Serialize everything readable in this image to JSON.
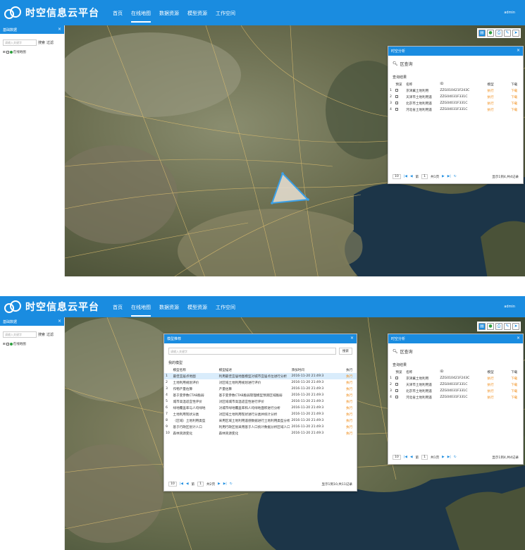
{
  "app": {
    "logo_text": "时空信息云平台",
    "nav": [
      "首页",
      "在线地图",
      "数据资源",
      "模型资源",
      "工作空间"
    ],
    "active_nav": "在线地图",
    "user": "admin"
  },
  "sidebar": {
    "title": "基础数据",
    "search_placeholder": "请输入关键字",
    "search_button": "搜索",
    "filter_button": "过滤",
    "tree_item": "在线地图"
  },
  "toolbar_icons": [
    "layers-icon",
    "globe-icon",
    "print-icon",
    "draw-icon",
    "pointer-icon"
  ],
  "query_panel": {
    "title": "时空分析",
    "query_label": "区查询",
    "result_title": "查询结果",
    "columns": [
      "预览",
      "名称",
      "ID",
      "模型",
      "下载"
    ],
    "rows": [
      {
        "n": "1",
        "name": "京津冀土地利用",
        "id": "ZZG010421F243C",
        "model": "执行",
        "dl": "下载"
      },
      {
        "n": "2",
        "name": "天津市土地利用遥",
        "id": "ZZG04031F331C",
        "model": "执行",
        "dl": "下载"
      },
      {
        "n": "3",
        "name": "北京市土地利用遥",
        "id": "ZZG04031F331C",
        "model": "执行",
        "dl": "下载"
      },
      {
        "n": "4",
        "name": "河北省土地利用遥",
        "id": "ZZG04031F331C",
        "model": "执行",
        "dl": "下载"
      }
    ],
    "pager": {
      "size": "10",
      "page_label": "第",
      "page": "1",
      "total": "共1页",
      "info": "显示1到4,共4记录"
    }
  },
  "model_panel": {
    "title": "模型推荐",
    "search_placeholder": "请输入关键字",
    "search_button": "搜索",
    "section": "我的模型",
    "columns": [
      "模型名称",
      "模型描述",
      "添加时间",
      "执行"
    ],
    "rows": [
      {
        "n": "1",
        "name": "最佳宜居点地图",
        "desc": "利用最佳宜居地图模型对城市宜居点位进行分析",
        "time": "2016-11-20 21:49:3",
        "exec": "执行"
      },
      {
        "n": "2",
        "name": "土地利用规划评价",
        "desc": "对区域土地利用规划进行评价",
        "time": "2016-11-20 21:49:3",
        "exec": "执行"
      },
      {
        "n": "3",
        "name": "作物产量估算",
        "desc": "产量估算",
        "time": "2016-11-20 21:49:3",
        "exec": "执行"
      },
      {
        "n": "4",
        "name": "基于变参数CTAB脆弱",
        "desc": "基于变参数CTAB脆弱管理模型预测区域脆弱",
        "time": "2016-11-20 21:49:3",
        "exec": "执行"
      },
      {
        "n": "5",
        "name": "城市高温适宜性评价",
        "desc": "对区域城市高温适宜性进行评价",
        "time": "2016-11-20 21:49:3",
        "exec": "执行"
      },
      {
        "n": "6",
        "name": "绿地覆盖率与人均绿地",
        "desc": "对城市绿地覆盖率和人均绿地面积进行分析",
        "time": "2016-11-20 21:49:3",
        "exec": "执行"
      },
      {
        "n": "7",
        "name": "土地利用现状分类",
        "desc": "对区域土地利用现状进行分类并统计分析",
        "time": "2016-11-20 21:49:3",
        "exec": "执行"
      },
      {
        "n": "8",
        "name": "（区域）土地利用类型",
        "desc": "采用区域土地利用遥感数据进行土地利用类型分析",
        "time": "2016-11-20 21:49:3",
        "exec": "执行"
      },
      {
        "n": "9",
        "name": "基于行政区划计人口",
        "desc": "利用行政区划采用基于人口统计数据分析区域人口",
        "time": "2016-11-20 21:49:3",
        "exec": "执行"
      },
      {
        "n": "10",
        "name": "森林资源变化",
        "desc": "森林资源变化",
        "time": "2016-11-20 21:49:3",
        "exec": "执行"
      }
    ],
    "pager": {
      "size": "10",
      "page_label": "第",
      "page": "1",
      "total": "共2页",
      "info": "显示1到10,共11记录"
    }
  }
}
